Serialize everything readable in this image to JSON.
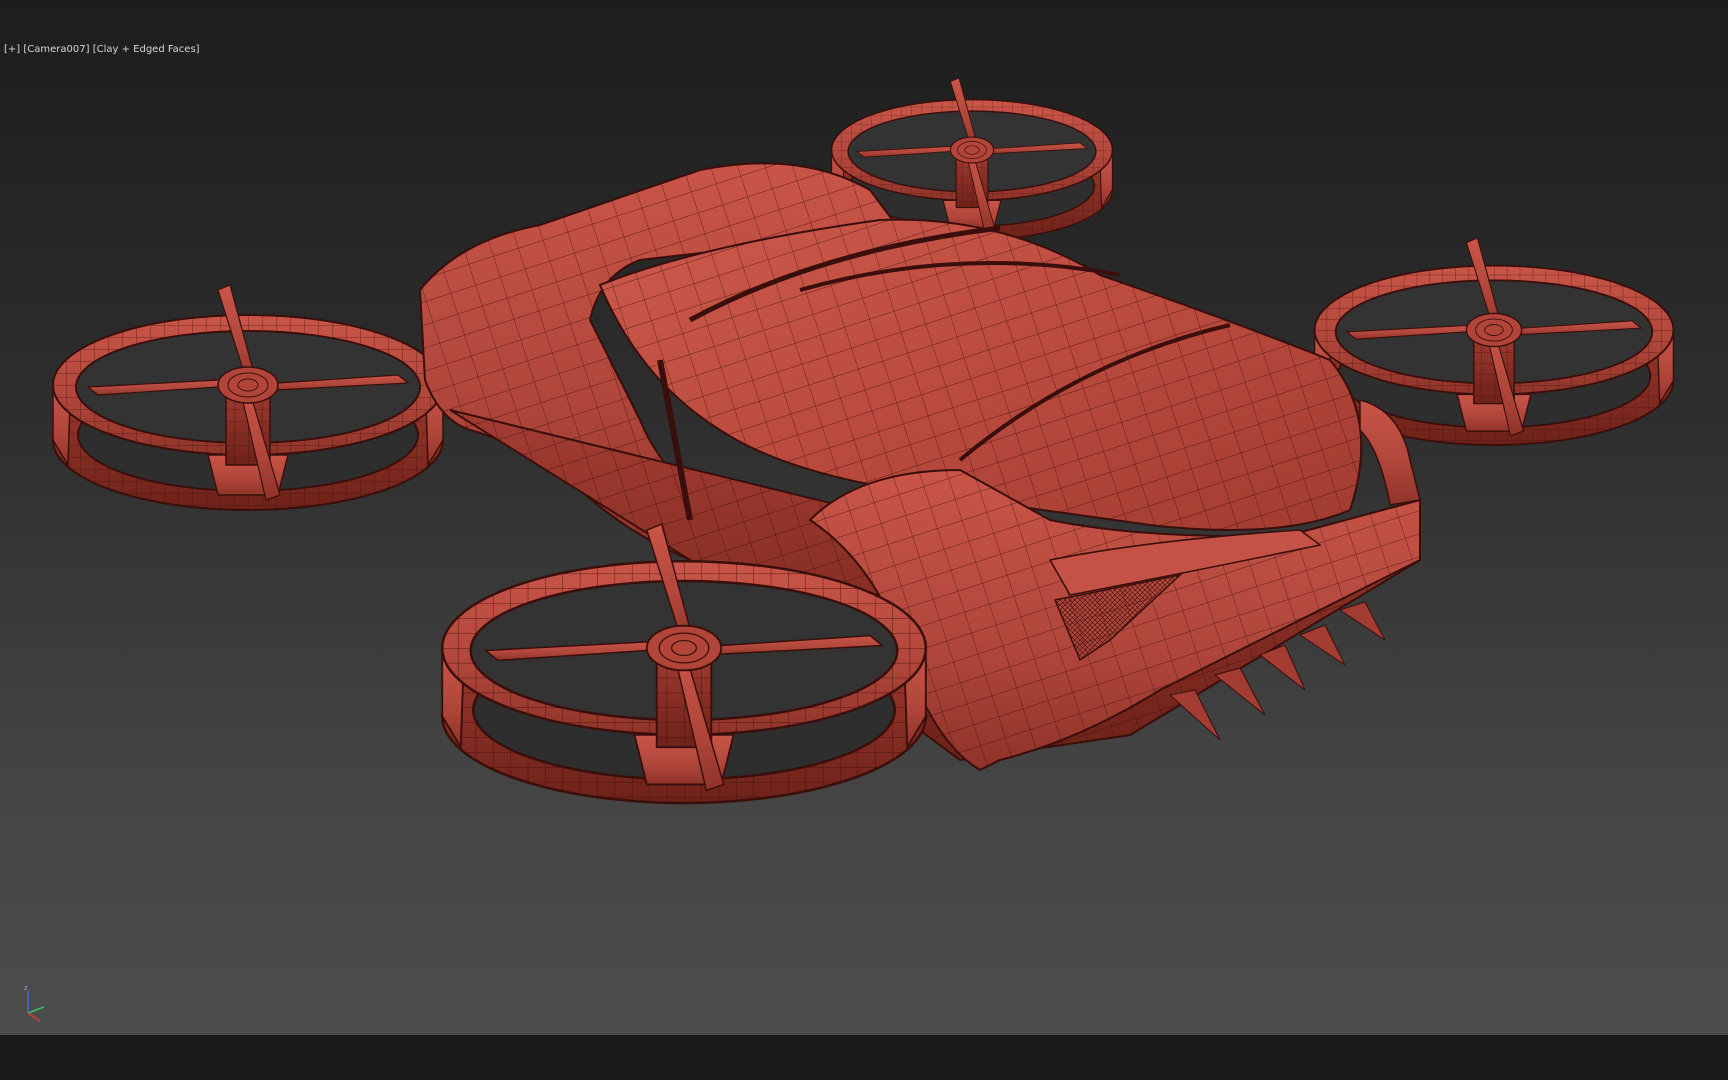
{
  "viewport": {
    "label_plus": "[+]",
    "label_camera": "[Camera007]",
    "label_shading": "[Clay + Edged Faces]"
  },
  "scene": {
    "model": "flying car drone with four ducted rotors",
    "clay_color": "#b5443a",
    "edge_color": "#3a0e0b"
  },
  "axis_gizmo": {
    "z_label": "z",
    "x_color": "#d83a3a",
    "y_color": "#3ac25a",
    "z_color": "#4a6ad8"
  },
  "colors": {
    "background_top": "#1d1d1d",
    "background_bottom": "#4d4d4d",
    "label_text": "#d6d6d6"
  }
}
